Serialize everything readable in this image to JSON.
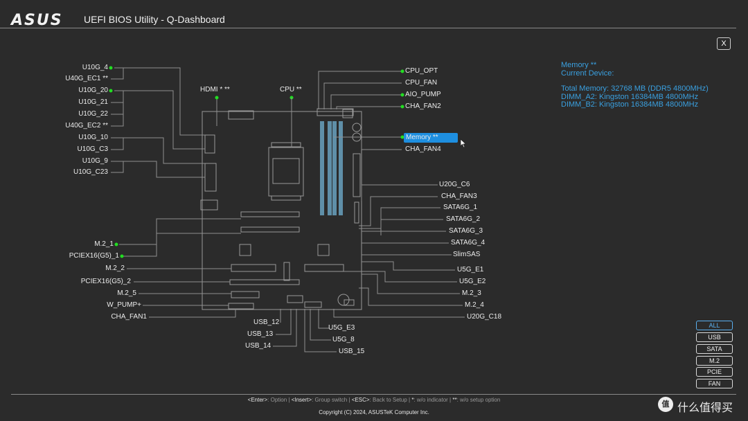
{
  "header": {
    "logo": "ASUS",
    "title": "UEFI BIOS Utility - Q-Dashboard",
    "close_label": "X"
  },
  "info": {
    "heading": "Memory **",
    "subheading": "Current Device:",
    "lines": [
      "Total Memory: 32768 MB (DDR5 4800MHz)",
      "DIMM_A2: Kingston 16384MB 4800MHz",
      "DIMM_B2: Kingston 16384MB 4800MHz"
    ]
  },
  "left_labels": [
    "U10G_4",
    "U40G_EC1 **",
    "U10G_20",
    "U10G_21",
    "U10G_22",
    "U40G_EC2 **",
    "U10G_10",
    "U10G_C3",
    "U10G_9",
    "U10G_C23",
    "M.2_1",
    "PCIEX16(G5)_1",
    "M.2_2",
    "PCIEX16(G5)_2",
    "M.2_5",
    "W_PUMP+",
    "CHA_FAN1"
  ],
  "top_labels": [
    "HDMI * **",
    "CPU **"
  ],
  "right_labels": [
    "CPU_OPT",
    "CPU_FAN",
    "AIO_PUMP",
    "CHA_FAN2",
    "Memory **",
    "CHA_FAN4",
    "U20G_C6",
    "CHA_FAN3",
    "SATA6G_1",
    "SATA6G_2",
    "SATA6G_3",
    "SATA6G_4",
    "SlimSAS",
    "U5G_E1",
    "U5G_E2",
    "M.2_3",
    "M.2_4",
    "U20G_C18"
  ],
  "bottom_labels": [
    "USB_12",
    "USB_13",
    "USB_14",
    "U5G_E3",
    "U5G_8",
    "USB_15"
  ],
  "filters": [
    {
      "label": "ALL",
      "active": true
    },
    {
      "label": "USB",
      "active": false
    },
    {
      "label": "SATA",
      "active": false
    },
    {
      "label": "M.2",
      "active": false
    },
    {
      "label": "PCIE",
      "active": false
    },
    {
      "label": "FAN",
      "active": false
    }
  ],
  "footer": {
    "help": [
      {
        "key": "<Enter>",
        "desc": "Option"
      },
      {
        "key": "<Insert>",
        "desc": "Group switch"
      },
      {
        "key": "<ESC>",
        "desc": "Back to Setup"
      },
      {
        "key": "*",
        "desc": "w/o indicator"
      },
      {
        "key": "**",
        "desc": "w/o setup option"
      }
    ],
    "copyright": "Copyright (C) 2024, ASUSTeK Computer Inc."
  },
  "watermark": {
    "badge": "值",
    "text": "什么值得买"
  },
  "colors": {
    "background": "#2b2b2b",
    "accent": "#3aa0e0",
    "indicator": "#22dd22",
    "highlight": "#1e8fe0",
    "dimm": "#5f8fa8"
  }
}
